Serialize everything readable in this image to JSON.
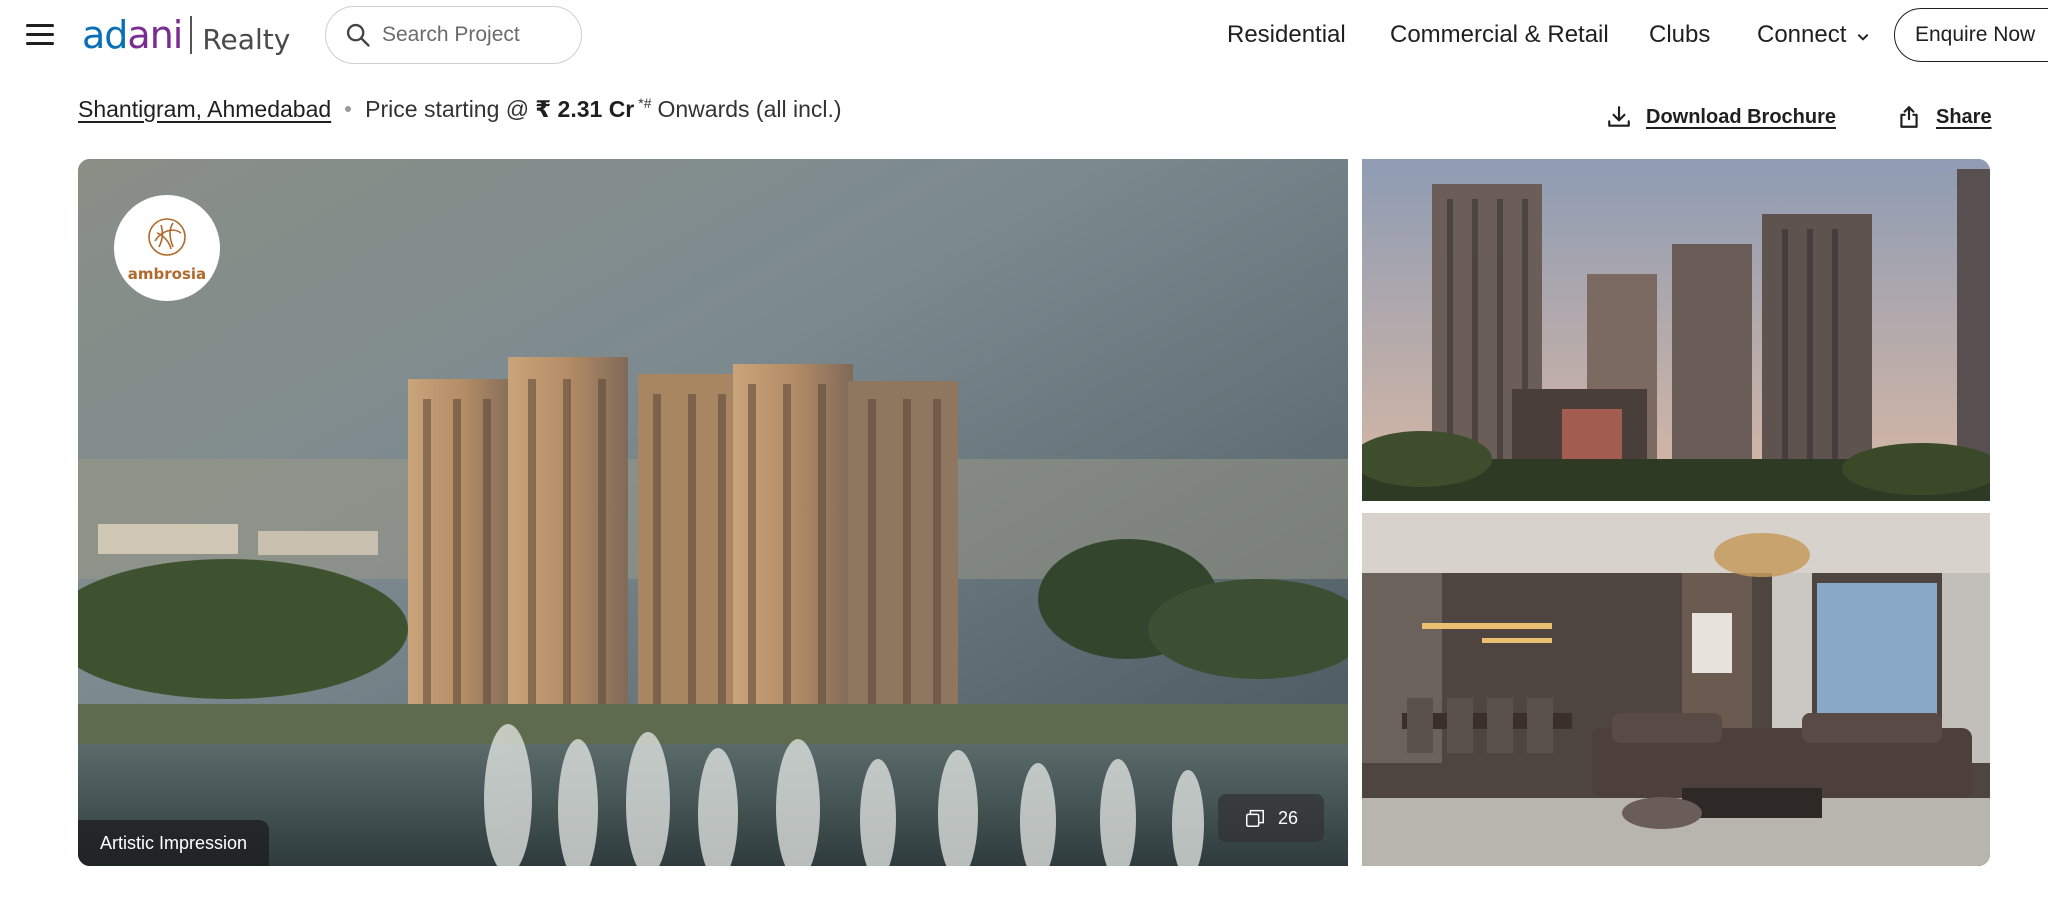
{
  "header": {
    "logo_word": "adani",
    "logo_sub": "Realty",
    "search_placeholder": "Search Project",
    "nav": {
      "residential": "Residential",
      "commercial": "Commercial & Retail",
      "clubs": "Clubs",
      "connect": "Connect"
    },
    "enquire_label": "Enquire Now"
  },
  "project": {
    "location": "Shantigram, Ahmedabad",
    "price_prefix": "Price starting @ ",
    "price_value": "₹ 2.31 Cr",
    "price_marker": "*#",
    "price_suffix": "Onwards (all incl.)"
  },
  "actions": {
    "download": "Download Brochure",
    "share": "Share"
  },
  "gallery": {
    "brand_badge": "ambrosia",
    "impression_tag": "Artistic Impression",
    "photo_count": "26"
  },
  "colors": {
    "brand_blue": "#0a6fb5",
    "brand_purple": "#7a2d8e",
    "badge_gold": "#b06a2c"
  }
}
